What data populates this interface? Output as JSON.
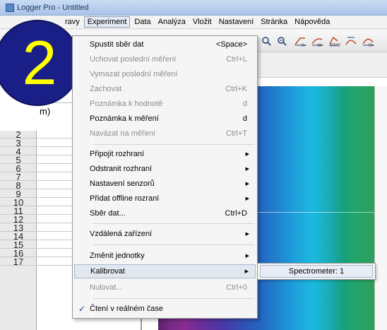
{
  "window": {
    "title": "Logger Pro - Untitled"
  },
  "menubar": {
    "items": [
      {
        "label": "ravy",
        "active": false
      },
      {
        "label": "Experiment",
        "active": true
      },
      {
        "label": "Data",
        "active": false
      },
      {
        "label": "Analýza",
        "active": false
      },
      {
        "label": "Vložit",
        "active": false
      },
      {
        "label": "Nastavení",
        "active": false
      },
      {
        "label": "Stránka",
        "active": false
      },
      {
        "label": "Nápověda",
        "active": false
      }
    ]
  },
  "toolbar": {
    "icons": [
      {
        "name": "zoom-in-icon",
        "glyph": "🔍"
      },
      {
        "name": "zoom-out-icon",
        "glyph": "🔍"
      },
      {
        "name": "fit-x-icon",
        "glyph": "⟋",
        "sub": "X="
      },
      {
        "name": "fit-m-icon",
        "glyph": "⟋",
        "sub": "M="
      },
      {
        "name": "stat-icon",
        "glyph": "⟋",
        "sub": "STAT"
      },
      {
        "name": "tangent-icon",
        "glyph": "⟋"
      },
      {
        "name": "integral-icon",
        "glyph": "⟋",
        "sub": "R="
      }
    ]
  },
  "table": {
    "header_fragment": "m)",
    "rows": [
      "2",
      "3",
      "4",
      "5",
      "6",
      "7",
      "8",
      "9",
      "10",
      "11",
      "12",
      "13",
      "14",
      "15",
      "16",
      "17"
    ]
  },
  "badge": {
    "digit": "2"
  },
  "experiment_menu": {
    "items": [
      {
        "label": "Spustit sběr dat",
        "shortcut": "<Space>",
        "disabled": false
      },
      {
        "label": "Uchovat poslední měření",
        "shortcut": "Ctrl+L",
        "disabled": true
      },
      {
        "label": "Vymazat poslední měření",
        "shortcut": "",
        "disabled": true
      },
      {
        "label": "Zachovat",
        "shortcut": "Ctrl+K",
        "disabled": true
      },
      {
        "label": "Poznámka k hodnotě",
        "shortcut": "d",
        "disabled": true
      },
      {
        "label": "Poznámka k měření",
        "shortcut": "d",
        "disabled": false
      },
      {
        "label": "Navázat na měření",
        "shortcut": "Ctrl+T",
        "disabled": true
      },
      {
        "label": "Připojit rozhraní",
        "submenu": true,
        "disabled": false
      },
      {
        "label": "Odstranit rozhraní",
        "submenu": true,
        "disabled": false
      },
      {
        "label": "Nastavení senzorů",
        "submenu": true,
        "disabled": false
      },
      {
        "label": "Přidat offline rozraní",
        "submenu": true,
        "disabled": false
      },
      {
        "label": "Sběr dat...",
        "shortcut": "Ctrl+D",
        "disabled": false
      },
      {
        "label": "Vzdálená zařízení",
        "submenu": true,
        "disabled": false
      },
      {
        "label": "Změnit jednotky",
        "submenu": true,
        "disabled": false
      },
      {
        "label": "Kalibrovat",
        "submenu": true,
        "disabled": false,
        "highlight": true
      },
      {
        "label": "Nulovat...",
        "shortcut": "Ctrl+0",
        "disabled": true
      },
      {
        "label": "Čtení v reálném čase",
        "checked": true,
        "disabled": false
      }
    ]
  },
  "calibrate_submenu": {
    "items": [
      {
        "label": "Spectrometer: 1"
      }
    ]
  }
}
